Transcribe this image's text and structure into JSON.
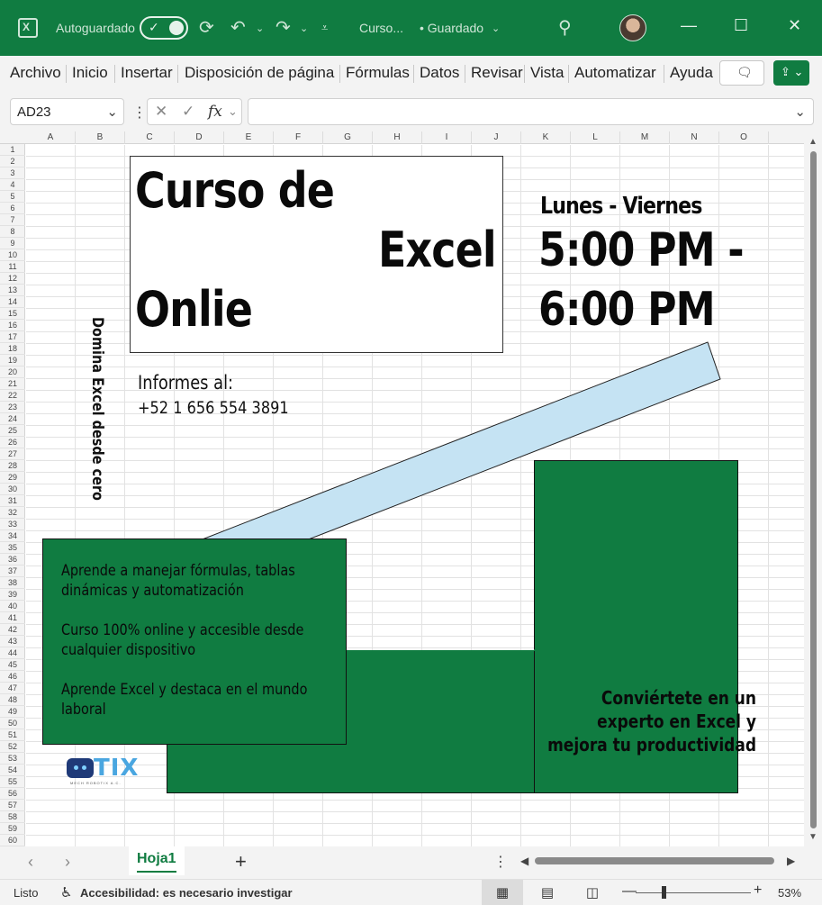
{
  "titlebar": {
    "autosave_label": "Autoguardado",
    "doc_name": "Curso...",
    "saved_status": "• Guardado"
  },
  "menu": [
    "Archivo",
    "Inicio",
    "Insertar",
    "Disposición de página",
    "Fórmulas",
    "Datos",
    "Revisar",
    "Vista",
    "Automatizar",
    "Ayuda"
  ],
  "formula_bar": {
    "name_box": "AD23",
    "fx_label": "fx",
    "formula_value": ""
  },
  "columns": [
    "A",
    "B",
    "C",
    "D",
    "E",
    "F",
    "G",
    "H",
    "I",
    "J",
    "K",
    "L",
    "M",
    "N",
    "O"
  ],
  "row_count": 60,
  "sheet": {
    "title_line1": "Curso de",
    "title_line2": "Excel",
    "title_line3": "Onlie",
    "schedule_days": "Lunes - Viernes",
    "schedule_time1": "5:00 PM -",
    "schedule_time2": "6:00 PM",
    "info_label": "Informes al:",
    "info_phone": "+52 1 656 554 3891",
    "vertical_text": "Domina Excel desde cero",
    "bullet1": "Aprende a manejar fórmulas, tablas dinámicas y automatización",
    "bullet2": "Curso 100% online y accesible desde cualquier dispositivo",
    "bullet3": "Aprende Excel y destaca en el mundo laboral",
    "cta": "Conviértete en un experto en Excel y mejora tu productividad",
    "logo_word": "TIX",
    "logo_sub": "MECH ROBOTIX A.C."
  },
  "tabs": {
    "active_sheet": "Hoja1"
  },
  "statusbar": {
    "ready": "Listo",
    "accessibility": "Accesibilidad: es necesario investigar",
    "zoom": "53%"
  },
  "colors": {
    "excel_green": "#107c41",
    "banner_blue": "#c5e3f3"
  }
}
